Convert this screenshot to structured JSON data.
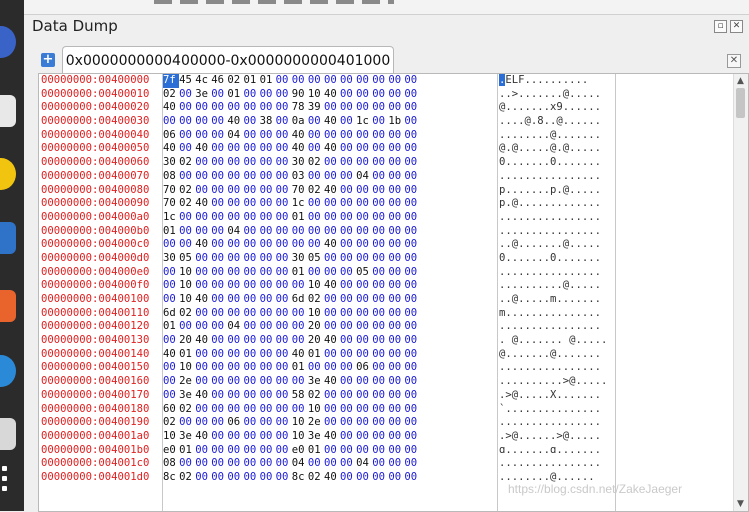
{
  "panel_title": "Data Dump",
  "tab_label": "0x0000000000400000-0x0000000000401000",
  "watermark": "https://blog.csdn.net/ZakeJaeger",
  "colors": {
    "address": "#e02020",
    "zero_byte": "#1a1ad8",
    "selection": "#2b6fd6"
  },
  "icons": {
    "add": "plus-icon",
    "close": "close-icon",
    "restore": "restore-icon"
  },
  "rows": [
    {
      "addr": "00000000:00400000",
      "hex": [
        "7f",
        "45",
        "4c",
        "46",
        "02",
        "01",
        "01",
        "00",
        "00",
        "00",
        "00",
        "00",
        "00",
        "00",
        "00",
        "00"
      ],
      "ascii": "ELF.........."
    },
    {
      "addr": "00000000:00400010",
      "hex": [
        "02",
        "00",
        "3e",
        "00",
        "01",
        "00",
        "00",
        "00",
        "90",
        "10",
        "40",
        "00",
        "00",
        "00",
        "00",
        "00"
      ],
      "ascii": "..>.......@....."
    },
    {
      "addr": "00000000:00400020",
      "hex": [
        "40",
        "00",
        "00",
        "00",
        "00",
        "00",
        "00",
        "00",
        "78",
        "39",
        "00",
        "00",
        "00",
        "00",
        "00",
        "00"
      ],
      "ascii": "@.......x9......"
    },
    {
      "addr": "00000000:00400030",
      "hex": [
        "00",
        "00",
        "00",
        "00",
        "40",
        "00",
        "38",
        "00",
        "0a",
        "00",
        "40",
        "00",
        "1c",
        "00",
        "1b",
        "00"
      ],
      "ascii": "....@.8..@......"
    },
    {
      "addr": "00000000:00400040",
      "hex": [
        "06",
        "00",
        "00",
        "00",
        "04",
        "00",
        "00",
        "00",
        "40",
        "00",
        "00",
        "00",
        "00",
        "00",
        "00",
        "00"
      ],
      "ascii": "........@......."
    },
    {
      "addr": "00000000:00400050",
      "hex": [
        "40",
        "00",
        "40",
        "00",
        "00",
        "00",
        "00",
        "00",
        "40",
        "00",
        "40",
        "00",
        "00",
        "00",
        "00",
        "00"
      ],
      "ascii": "@.@.....@.@....."
    },
    {
      "addr": "00000000:00400060",
      "hex": [
        "30",
        "02",
        "00",
        "00",
        "00",
        "00",
        "00",
        "00",
        "30",
        "02",
        "00",
        "00",
        "00",
        "00",
        "00",
        "00"
      ],
      "ascii": "0.......0......."
    },
    {
      "addr": "00000000:00400070",
      "hex": [
        "08",
        "00",
        "00",
        "00",
        "00",
        "00",
        "00",
        "00",
        "03",
        "00",
        "00",
        "00",
        "04",
        "00",
        "00",
        "00"
      ],
      "ascii": "................"
    },
    {
      "addr": "00000000:00400080",
      "hex": [
        "70",
        "02",
        "00",
        "00",
        "00",
        "00",
        "00",
        "00",
        "70",
        "02",
        "40",
        "00",
        "00",
        "00",
        "00",
        "00"
      ],
      "ascii": "p.......p.@....."
    },
    {
      "addr": "00000000:00400090",
      "hex": [
        "70",
        "02",
        "40",
        "00",
        "00",
        "00",
        "00",
        "00",
        "1c",
        "00",
        "00",
        "00",
        "00",
        "00",
        "00",
        "00"
      ],
      "ascii": "p.@............."
    },
    {
      "addr": "00000000:004000a0",
      "hex": [
        "1c",
        "00",
        "00",
        "00",
        "00",
        "00",
        "00",
        "00",
        "01",
        "00",
        "00",
        "00",
        "00",
        "00",
        "00",
        "00"
      ],
      "ascii": "................"
    },
    {
      "addr": "00000000:004000b0",
      "hex": [
        "01",
        "00",
        "00",
        "00",
        "04",
        "00",
        "00",
        "00",
        "00",
        "00",
        "00",
        "00",
        "00",
        "00",
        "00",
        "00"
      ],
      "ascii": "................"
    },
    {
      "addr": "00000000:004000c0",
      "hex": [
        "00",
        "00",
        "40",
        "00",
        "00",
        "00",
        "00",
        "00",
        "00",
        "00",
        "40",
        "00",
        "00",
        "00",
        "00",
        "00"
      ],
      "ascii": "..@.......@....."
    },
    {
      "addr": "00000000:004000d0",
      "hex": [
        "30",
        "05",
        "00",
        "00",
        "00",
        "00",
        "00",
        "00",
        "30",
        "05",
        "00",
        "00",
        "00",
        "00",
        "00",
        "00"
      ],
      "ascii": "0.......0......."
    },
    {
      "addr": "00000000:004000e0",
      "hex": [
        "00",
        "10",
        "00",
        "00",
        "00",
        "00",
        "00",
        "00",
        "01",
        "00",
        "00",
        "00",
        "05",
        "00",
        "00",
        "00"
      ],
      "ascii": "................"
    },
    {
      "addr": "00000000:004000f0",
      "hex": [
        "00",
        "10",
        "00",
        "00",
        "00",
        "00",
        "00",
        "00",
        "00",
        "10",
        "40",
        "00",
        "00",
        "00",
        "00",
        "00"
      ],
      "ascii": "..........@....."
    },
    {
      "addr": "00000000:00400100",
      "hex": [
        "00",
        "10",
        "40",
        "00",
        "00",
        "00",
        "00",
        "00",
        "6d",
        "02",
        "00",
        "00",
        "00",
        "00",
        "00",
        "00"
      ],
      "ascii": "..@.....m......."
    },
    {
      "addr": "00000000:00400110",
      "hex": [
        "6d",
        "02",
        "00",
        "00",
        "00",
        "00",
        "00",
        "00",
        "00",
        "10",
        "00",
        "00",
        "00",
        "00",
        "00",
        "00"
      ],
      "ascii": "m..............."
    },
    {
      "addr": "00000000:00400120",
      "hex": [
        "01",
        "00",
        "00",
        "00",
        "04",
        "00",
        "00",
        "00",
        "00",
        "20",
        "00",
        "00",
        "00",
        "00",
        "00",
        "00"
      ],
      "ascii": "................"
    },
    {
      "addr": "00000000:00400130",
      "hex": [
        "00",
        "20",
        "40",
        "00",
        "00",
        "00",
        "00",
        "00",
        "00",
        "20",
        "40",
        "00",
        "00",
        "00",
        "00",
        "00"
      ],
      "ascii": ". @....... @....."
    },
    {
      "addr": "00000000:00400140",
      "hex": [
        "40",
        "01",
        "00",
        "00",
        "00",
        "00",
        "00",
        "00",
        "40",
        "01",
        "00",
        "00",
        "00",
        "00",
        "00",
        "00"
      ],
      "ascii": "@.......@......."
    },
    {
      "addr": "00000000:00400150",
      "hex": [
        "00",
        "10",
        "00",
        "00",
        "00",
        "00",
        "00",
        "00",
        "01",
        "00",
        "00",
        "00",
        "06",
        "00",
        "00",
        "00"
      ],
      "ascii": "................"
    },
    {
      "addr": "00000000:00400160",
      "hex": [
        "00",
        "2e",
        "00",
        "00",
        "00",
        "00",
        "00",
        "00",
        "00",
        "3e",
        "40",
        "00",
        "00",
        "00",
        "00",
        "00"
      ],
      "ascii": "..........>@....."
    },
    {
      "addr": "00000000:00400170",
      "hex": [
        "00",
        "3e",
        "40",
        "00",
        "00",
        "00",
        "00",
        "00",
        "58",
        "02",
        "00",
        "00",
        "00",
        "00",
        "00",
        "00"
      ],
      "ascii": ".>@.....X......."
    },
    {
      "addr": "00000000:00400180",
      "hex": [
        "60",
        "02",
        "00",
        "00",
        "00",
        "00",
        "00",
        "00",
        "00",
        "10",
        "00",
        "00",
        "00",
        "00",
        "00",
        "00"
      ],
      "ascii": "`..............."
    },
    {
      "addr": "00000000:00400190",
      "hex": [
        "02",
        "00",
        "00",
        "00",
        "06",
        "00",
        "00",
        "00",
        "10",
        "2e",
        "00",
        "00",
        "00",
        "00",
        "00",
        "00"
      ],
      "ascii": "................"
    },
    {
      "addr": "00000000:004001a0",
      "hex": [
        "10",
        "3e",
        "40",
        "00",
        "00",
        "00",
        "00",
        "00",
        "10",
        "3e",
        "40",
        "00",
        "00",
        "00",
        "00",
        "00"
      ],
      "ascii": ".>@......>@....."
    },
    {
      "addr": "00000000:004001b0",
      "hex": [
        "e0",
        "01",
        "00",
        "00",
        "00",
        "00",
        "00",
        "00",
        "e0",
        "01",
        "00",
        "00",
        "00",
        "00",
        "00",
        "00"
      ],
      "ascii": "ɑ.......ɑ......."
    },
    {
      "addr": "00000000:004001c0",
      "hex": [
        "08",
        "00",
        "00",
        "00",
        "00",
        "00",
        "00",
        "00",
        "04",
        "00",
        "00",
        "00",
        "04",
        "00",
        "00",
        "00"
      ],
      "ascii": "................"
    },
    {
      "addr": "00000000:004001d0",
      "hex": [
        "8c",
        "02",
        "00",
        "00",
        "00",
        "00",
        "00",
        "00",
        "8c",
        "02",
        "40",
        "00",
        "00",
        "00",
        "00",
        "00"
      ],
      "ascii": "........@......"
    }
  ]
}
